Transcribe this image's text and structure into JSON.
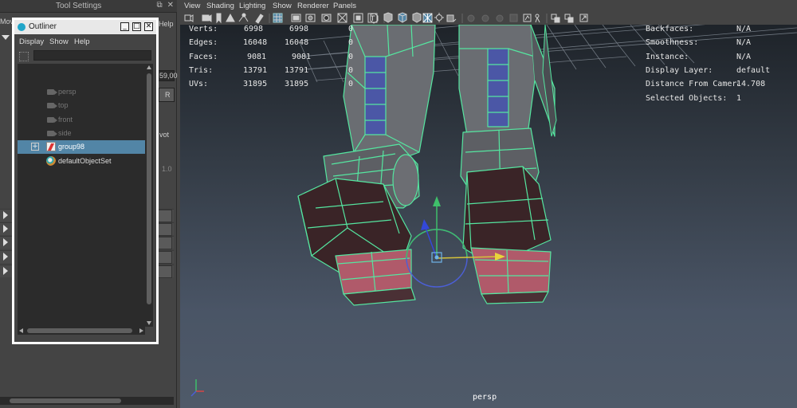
{
  "tool_settings": {
    "title": "Tool Settings",
    "frag_left": "Mov",
    "frag_help": "Help",
    "frag_value": "59,00",
    "frag_r": "R",
    "frag_pivot": "vot",
    "frag_num": "1.0"
  },
  "outliner": {
    "title": "Outliner",
    "menus": [
      "Display",
      "Show",
      "Help"
    ],
    "items": [
      {
        "label": "persp"
      },
      {
        "label": "top"
      },
      {
        "label": "front"
      },
      {
        "label": "side"
      },
      {
        "label": "group98"
      },
      {
        "label": "defaultObjectSet"
      }
    ],
    "selected_color": "#5285a6"
  },
  "viewport": {
    "menus": [
      "View",
      "Shading",
      "Lighting",
      "Show",
      "Renderer",
      "Panels"
    ],
    "camera": "persp",
    "hud_left": {
      "rows": [
        {
          "label": "Verts:",
          "v1": "6998",
          "v2": "6998",
          "v3": "0"
        },
        {
          "label": "Edges:",
          "v1": "16048",
          "v2": "16048",
          "v3": "0"
        },
        {
          "label": "Faces:",
          "v1": "9081",
          "v2": "9081",
          "v3": "0"
        },
        {
          "label": "Tris:",
          "v1": "13791",
          "v2": "13791",
          "v3": "0"
        },
        {
          "label": "UVs:",
          "v1": "31895",
          "v2": "31895",
          "v3": "0"
        }
      ]
    },
    "hud_right": {
      "rows": [
        {
          "label": "Backfaces:",
          "value": "N/A"
        },
        {
          "label": "Smoothness:",
          "value": "N/A"
        },
        {
          "label": "Instance:",
          "value": "N/A"
        },
        {
          "label": "Display Layer:",
          "value": "default"
        },
        {
          "label": "Distance From Camera:",
          "value": "14.708"
        },
        {
          "label": "Selected Objects:",
          "value": "1"
        }
      ]
    },
    "wire_color": "#55e6a0"
  }
}
